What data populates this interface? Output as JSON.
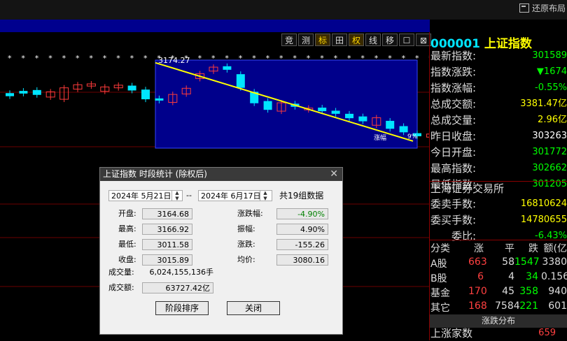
{
  "top": {
    "restore_label": "还原布局"
  },
  "toolbar": [
    "竞",
    "测",
    "标",
    "田",
    "权",
    "线",
    "移",
    "☐",
    "⊠"
  ],
  "header": {
    "code": "000001",
    "name": "上证指数"
  },
  "quote": [
    {
      "k": "最新指数:",
      "v": "301589",
      "c": "#00ff00"
    },
    {
      "k": "指数涨跌:",
      "v": "▼1674",
      "c": "#00ff00"
    },
    {
      "k": "指数涨幅:",
      "v": "-0.55%",
      "c": "#00ff00"
    },
    {
      "k": "总成交额:",
      "v": "3381.47亿",
      "c": "#ffff00"
    },
    {
      "k": "总成交量:",
      "v": "2.96亿",
      "c": "#ffff00"
    },
    {
      "k": "昨日收盘:",
      "v": "303263",
      "c": "#ffffff"
    },
    {
      "k": "今日开盘:",
      "v": "301772",
      "c": "#00ff00"
    },
    {
      "k": "最高指数:",
      "v": "302662",
      "c": "#00ff00"
    },
    {
      "k": "最低指数:",
      "v": "301205",
      "c": "#00ff00"
    }
  ],
  "exchange": {
    "title": "上海证券交易所",
    "rows": [
      {
        "k": "委卖手数:",
        "v": "16810624",
        "c": "#ffff00"
      },
      {
        "k": "委买手数:",
        "v": "14780655",
        "c": "#ffff00"
      },
      {
        "k": "委比:",
        "v": "-6.43%",
        "c": "#00ff00"
      }
    ]
  },
  "table": {
    "headers": [
      "分类",
      "涨",
      "平",
      "跌",
      "额(亿"
    ],
    "rows": [
      [
        "A股",
        "663",
        "58",
        "1547",
        "3380"
      ],
      [
        "B股",
        "6",
        "4",
        "34",
        "0.156"
      ],
      [
        "基金",
        "170",
        "45",
        "358",
        "940"
      ],
      [
        "其它",
        "168",
        "7584",
        "221",
        "601"
      ]
    ]
  },
  "dist": {
    "title": "涨跌分布",
    "label": "上涨家数",
    "value": "659"
  },
  "chart": {
    "price_label": "3174.27",
    "right_label": "9%",
    "mid_label": "涨幅"
  },
  "chart_data": {
    "type": "candlestick",
    "candles": [
      {
        "o": 3105,
        "c": 3098,
        "up": false
      },
      {
        "o": 3110,
        "c": 3104,
        "up": false
      },
      {
        "o": 3112,
        "c": 3101,
        "up": false
      },
      {
        "o": 3096,
        "c": 3108,
        "up": true
      },
      {
        "o": 3091,
        "c": 3117,
        "up": true
      },
      {
        "o": 3114,
        "c": 3124,
        "up": true
      },
      {
        "o": 3121,
        "c": 3126,
        "up": true
      },
      {
        "o": 3109,
        "c": 3119,
        "up": true
      },
      {
        "o": 3117,
        "c": 3123,
        "up": true
      },
      {
        "o": 3122,
        "c": 3111,
        "up": false
      },
      {
        "o": 3113,
        "c": 3091,
        "up": false
      },
      {
        "o": 3093,
        "c": 3088,
        "up": false
      },
      {
        "o": 3084,
        "c": 3102,
        "up": true
      },
      {
        "o": 3103,
        "c": 3116,
        "up": true
      },
      {
        "o": 3138,
        "c": 3149,
        "up": true
      },
      {
        "o": 3155,
        "c": 3164,
        "up": true
      },
      {
        "o": 3166,
        "c": 3158,
        "up": false
      },
      {
        "o": 3148,
        "c": 3117,
        "up": false
      },
      {
        "o": 3108,
        "c": 3082,
        "up": false
      },
      {
        "o": 3087,
        "c": 3067,
        "up": false
      },
      {
        "o": 3064,
        "c": 3083,
        "up": true
      },
      {
        "o": 3081,
        "c": 3074,
        "up": false
      },
      {
        "o": 3067,
        "c": 3071,
        "up": true
      },
      {
        "o": 3072,
        "c": 3064,
        "up": false
      },
      {
        "o": 3065,
        "c": 3058,
        "up": false
      },
      {
        "o": 3058,
        "c": 3048,
        "up": false
      },
      {
        "o": 3052,
        "c": 3041,
        "up": false
      },
      {
        "o": 3032,
        "c": 3049,
        "up": true
      },
      {
        "o": 3042,
        "c": 3024,
        "up": false
      },
      {
        "o": 3030,
        "c": 3016,
        "up": false
      },
      {
        "o": 3014,
        "c": 3007,
        "up": false
      },
      {
        "o": 3005,
        "c": 3012,
        "up": true
      },
      {
        "o": 3008,
        "c": 2997,
        "up": false
      },
      {
        "o": 3001,
        "c": 2995,
        "up": false
      },
      {
        "o": 2998,
        "c": 3005,
        "up": true
      },
      {
        "o": 3000,
        "c": 2996,
        "up": false
      }
    ],
    "ylim": [
      2980,
      3180
    ]
  },
  "dialog": {
    "title": "上证指数 时段统计 (除权后)",
    "start_date": "2024年  5月21日",
    "end_date": "2024年  6月17日",
    "sep": "--",
    "count": "共19组数据",
    "left": [
      {
        "k": "开盘:",
        "v": "3164.68"
      },
      {
        "k": "最高:",
        "v": "3166.92"
      },
      {
        "k": "最低:",
        "v": "3011.58"
      },
      {
        "k": "收盘:",
        "v": "3015.89"
      }
    ],
    "right": [
      {
        "k": "涨跌幅:",
        "v": "-4.90%",
        "c": "#008000"
      },
      {
        "k": "振幅:",
        "v": "4.90%",
        "c": "#000000"
      },
      {
        "k": "涨跌:",
        "v": "-155.26",
        "c": "#000000"
      },
      {
        "k": "均价:",
        "v": "3080.16",
        "c": "#000000"
      }
    ],
    "volume_label": "成交量:",
    "volume": "6,024,155,136手",
    "amount_label": "成交额:",
    "amount": "63727.42亿",
    "sort_button": "阶段排序",
    "close_button": "关闭"
  }
}
